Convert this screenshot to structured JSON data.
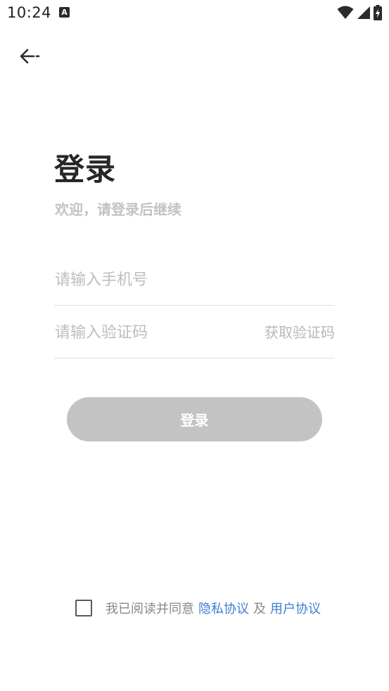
{
  "status_bar": {
    "time": "10:24",
    "notification_icon_letter": "A",
    "icons": [
      "wifi-icon",
      "signal-icon",
      "battery-charging-icon"
    ]
  },
  "nav": {
    "back_icon": "back-arrow-icon"
  },
  "header": {
    "title": "登录",
    "subtitle": "欢迎，请登录后继续"
  },
  "form": {
    "phone_placeholder": "请输入手机号",
    "phone_value": "",
    "code_placeholder": "请输入验证码",
    "code_value": "",
    "get_code_label": "获取验证码",
    "login_label": "登录"
  },
  "agreement": {
    "checked": false,
    "prefix": "我已阅读并同意",
    "privacy_label": "隐私协议",
    "and_label": "及",
    "user_label": "用户协议"
  },
  "colors": {
    "title": "#262626",
    "subtitle": "#c2c2c2",
    "placeholder": "#bdbdbd",
    "divider": "#dedede",
    "login_button_bg": "#c3c3c3",
    "link": "#3f7ed3"
  }
}
